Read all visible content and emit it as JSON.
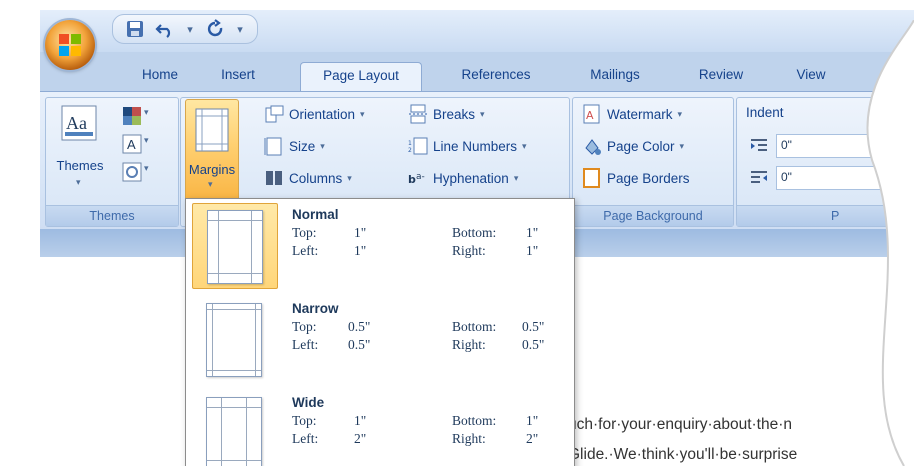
{
  "tabs": [
    {
      "label": "Home"
    },
    {
      "label": "Insert"
    },
    {
      "label": "Page Layout",
      "active": true
    },
    {
      "label": "References"
    },
    {
      "label": "Mailings"
    },
    {
      "label": "Review"
    },
    {
      "label": "View"
    }
  ],
  "groups": {
    "themes": {
      "label": "Themes",
      "themes_button": "Themes"
    },
    "page_setup": {
      "margins_button": "Margins",
      "orientation": "Orientation",
      "size": "Size",
      "columns": "Columns",
      "breaks": "Breaks",
      "line_numbers": "Line Numbers",
      "hyphenation": "Hyphenation"
    },
    "page_background": {
      "label": "Page Background",
      "watermark": "Watermark",
      "page_color": "Page Color",
      "page_borders": "Page Borders"
    },
    "paragraph": {
      "indent_label": "Indent",
      "indent_left_value": "0\"",
      "indent_right_value": "0\"",
      "label_partial": "P"
    }
  },
  "margins_menu": [
    {
      "name": "Normal",
      "top": "1\"",
      "bottom": "1\"",
      "left": "1\"",
      "right": "1\"",
      "selected": true
    },
    {
      "name": "Narrow",
      "top": "0.5\"",
      "bottom": "0.5\"",
      "left": "0.5\"",
      "right": "0.5\"",
      "selected": false
    },
    {
      "name": "Wide",
      "top": "1\"",
      "bottom": "1\"",
      "left": "2\"",
      "right": "2\"",
      "selected": false
    }
  ],
  "labels": {
    "top": "Top:",
    "bottom": "Bottom:",
    "left": "Left:",
    "right": "Right:"
  },
  "document": {
    "line1": "uch·for·your·enquiry·about·the·n",
    "line2": "Glide.·We·think·you'll·be·surprise"
  },
  "colors": {
    "accent": "#15428b",
    "ribbon": "#dbe7f6",
    "highlight": "#ffd67a"
  }
}
